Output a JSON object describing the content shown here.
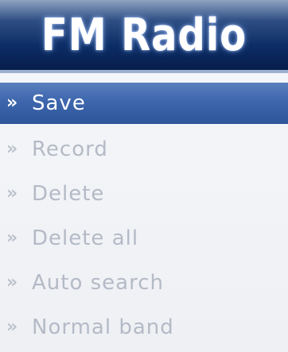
{
  "header": {
    "title": "FM Radio"
  },
  "menu": {
    "arrow_glyph": "»",
    "items": [
      {
        "label": "Save",
        "selected": true
      },
      {
        "label": "Record",
        "selected": false
      },
      {
        "label": "Delete",
        "selected": false
      },
      {
        "label": "Delete all",
        "selected": false
      },
      {
        "label": "Auto search",
        "selected": false
      },
      {
        "label": "Normal band",
        "selected": false
      }
    ]
  },
  "colors": {
    "title_bar": "#0c2d66",
    "selection": "#3d66ad",
    "unselected_text": "#b4bac6",
    "background": "#f6f7fa"
  }
}
